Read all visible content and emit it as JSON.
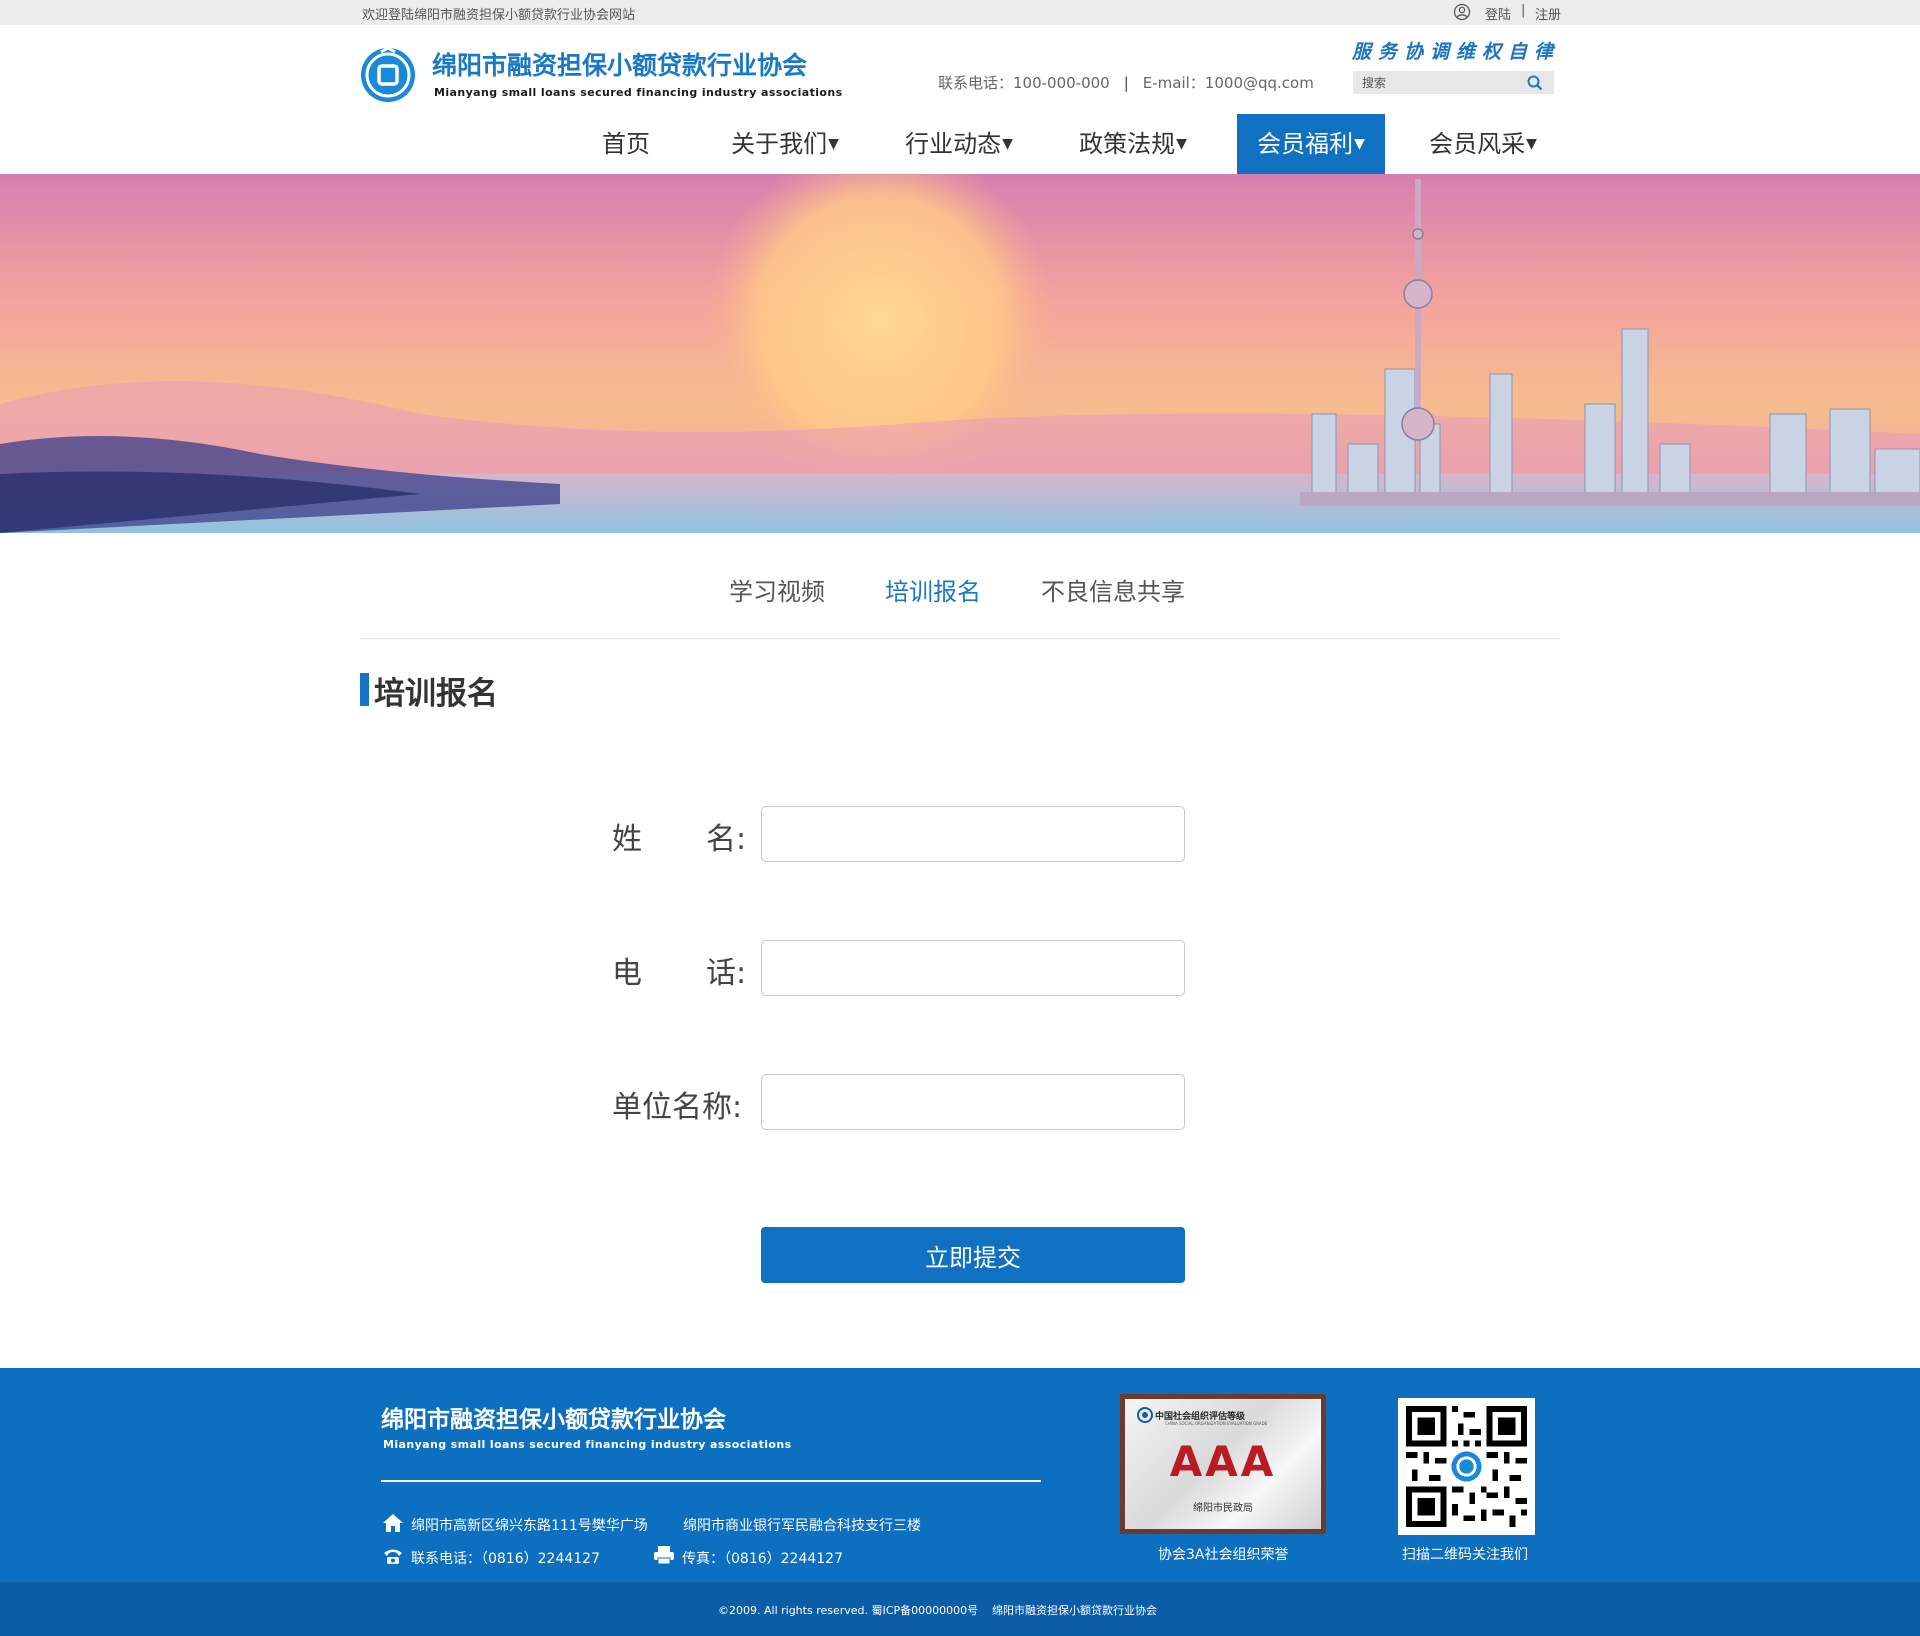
{
  "topbar": {
    "welcome": "欢迎登陆绵阳市融资担保小额贷款行业协会网站",
    "login": "登陆",
    "separator": "|",
    "register": "注册"
  },
  "header": {
    "logo_cn": "绵阳市融资担保小额贷款行业协会",
    "logo_en": "Mianyang small loans secured financing industry associations",
    "slogan": "服务协调维权自律",
    "phone": "联系电话：100-000-000",
    "separator": "|",
    "email": "E-mail：1000@qq.com",
    "search_placeholder": "搜索"
  },
  "nav": {
    "items": [
      {
        "label": "首页",
        "has_caret": false
      },
      {
        "label": "关于我们",
        "has_caret": true
      },
      {
        "label": "行业动态",
        "has_caret": true
      },
      {
        "label": "政策法规",
        "has_caret": true
      },
      {
        "label": "会员福利",
        "has_caret": true,
        "active": true
      },
      {
        "label": "会员风采",
        "has_caret": true
      }
    ],
    "caret": "▼"
  },
  "subnav": {
    "items": [
      {
        "label": "学习视频"
      },
      {
        "label": "培训报名",
        "active": true
      },
      {
        "label": "不良信息共享"
      }
    ]
  },
  "section": {
    "title": "培训报名"
  },
  "form": {
    "name_label_a": "姓",
    "name_label_b": "名:",
    "phone_label_a": "电",
    "phone_label_b": "话:",
    "company_label": "单位名称:",
    "name_value": "",
    "phone_value": "",
    "company_value": "",
    "submit": "立即提交"
  },
  "footer": {
    "org_cn": "绵阳市融资担保小额贷款行业协会",
    "org_en": "Mianyang small loans secured financing industry associations",
    "address1": "绵阳市高新区绵兴东路111号樊华广场",
    "address2": "绵阳市商业银行军民融合科技支行三楼",
    "phone": "联系电话：（0816）2244127",
    "fax": "传真：（0816）2244127",
    "award_caption": "协会3A社会组织荣誉",
    "qr_caption": "扫描二维码关注我们",
    "award_heading": "中国社会组织评估等级",
    "award_subheading": "CHINA SOCIAL ORGANIZATION EVALUATION GRADE",
    "award_grade": "AAA",
    "award_issuer": "绵阳市民政局",
    "copyright": "©2009. All rights reserved. 蜀ICP备00000000号",
    "copyright_org": "绵阳市融资担保小额贷款行业协会"
  },
  "colors": {
    "brand_blue": "#1071c2",
    "footer_blue": "#0d6fbf",
    "footer_dark": "#0b5ea6",
    "award_red": "#b81c22"
  },
  "icons": [
    "user-icon",
    "search-icon",
    "home-icon",
    "phone-icon",
    "fax-icon",
    "logo-icon"
  ]
}
